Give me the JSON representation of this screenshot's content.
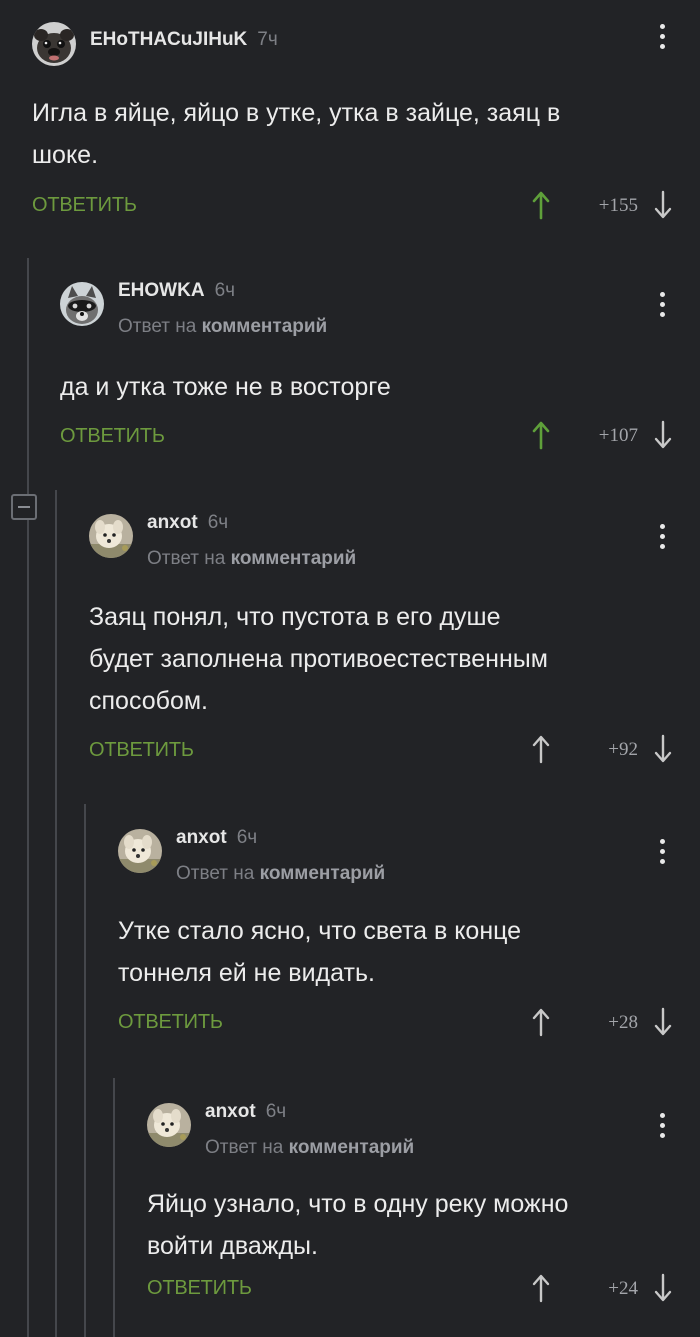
{
  "colors": {
    "background": "#222326",
    "reply_green": "#6d9a3e",
    "upvote_green": "#5fa03a",
    "thread_line": "#45474c"
  },
  "comments": [
    {
      "username": "EHoTHACuJIHuK",
      "time": "7ч",
      "reply_prefix": "",
      "reply_target": "",
      "text_lines": [
        "Игла в яйце, яйцо в утке, утка в зайце, заяц в",
        "шоке."
      ],
      "reply_label": "ОТВЕТИТЬ",
      "score": "+155",
      "upvoted": true,
      "avatar_icon": "pug-avatar"
    },
    {
      "username": "EHOWKA",
      "time": "6ч",
      "reply_prefix": "Ответ на",
      "reply_target": "комментарий",
      "text_lines": [
        "да и утка тоже не в восторге"
      ],
      "reply_label": "ОТВЕТИТЬ",
      "score": "+107",
      "upvoted": true,
      "avatar_icon": "raccoon-avatar"
    },
    {
      "username": "anxot",
      "time": "6ч",
      "reply_prefix": "Ответ на",
      "reply_target": "комментарий",
      "text_lines": [
        "Заяц понял, что пустота в его душе",
        "будет заполнена противоестественным",
        "способом."
      ],
      "reply_label": "ОТВЕТИТЬ",
      "score": "+92",
      "upvoted": false,
      "avatar_icon": "dog-avatar"
    },
    {
      "username": "anxot",
      "time": "6ч",
      "reply_prefix": "Ответ на",
      "reply_target": "комментарий",
      "text_lines": [
        "Утке стало ясно, что света в конце",
        "тоннеля ей не видать."
      ],
      "reply_label": "ОТВЕТИТЬ",
      "score": "+28",
      "upvoted": false,
      "avatar_icon": "dog-avatar"
    },
    {
      "username": "anxot",
      "time": "6ч",
      "reply_prefix": "Ответ на",
      "reply_target": "комментарий",
      "text_lines": [
        "Яйцо узнало, что в одну реку можно",
        "войти дважды."
      ],
      "reply_label": "ОТВЕТИТЬ",
      "score": "+24",
      "upvoted": false,
      "avatar_icon": "dog-avatar"
    }
  ]
}
